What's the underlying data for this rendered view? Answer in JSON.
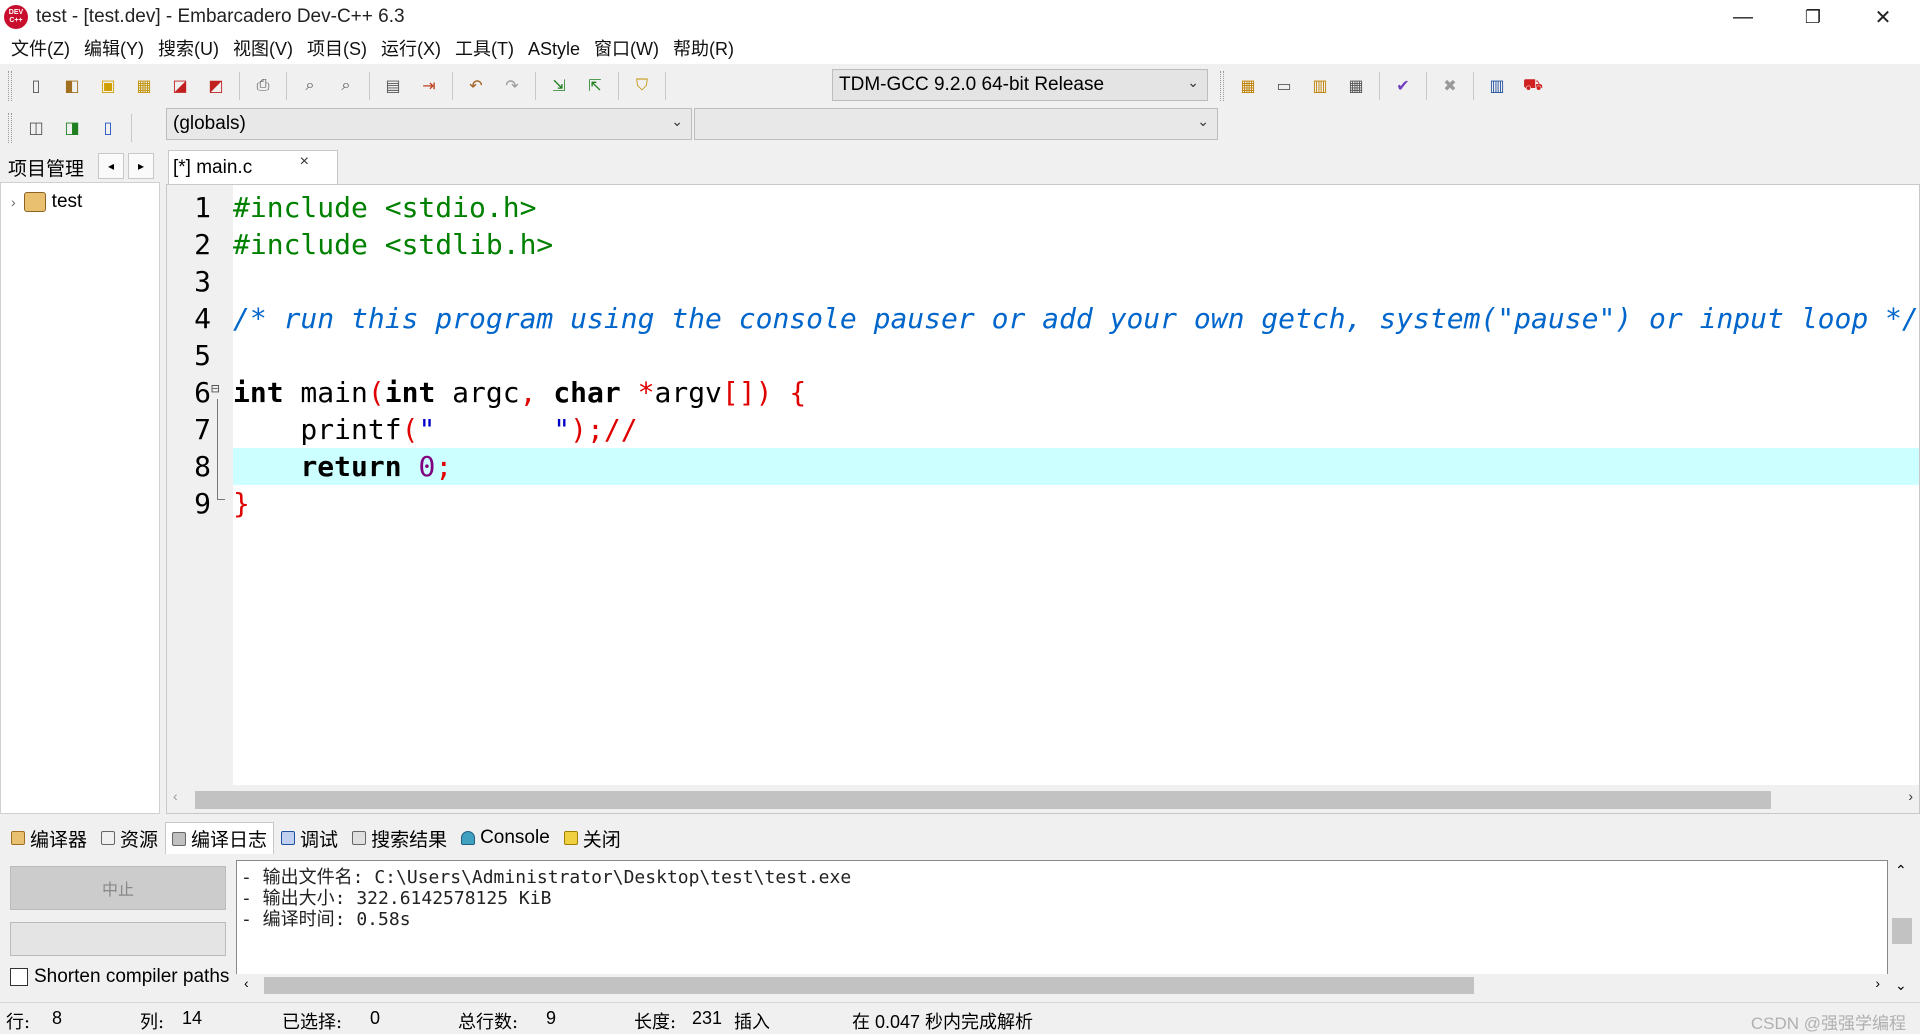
{
  "window": {
    "title": "test - [test.dev] - Embarcadero Dev-C++ 6.3",
    "app_icon_text": "DEV C++",
    "minimize": "—",
    "restore": "❐",
    "close": "✕"
  },
  "menu": [
    "文件(Z)",
    "编辑(Y)",
    "搜索(U)",
    "视图(V)",
    "项目(S)",
    "运行(X)",
    "工具(T)",
    "AStyle",
    "窗口(W)",
    "帮助(R)"
  ],
  "toolbar": {
    "compiler_select": "TDM-GCC 9.2.0 64-bit Release",
    "globals_select": "(globals)",
    "function_select": ""
  },
  "left_panel": {
    "tab_label": "项目管理",
    "prev": "◂",
    "next": "▸",
    "tree_root": "test",
    "expander": "›"
  },
  "editor": {
    "tab_label": "[*] main.c",
    "tab_close": "×",
    "line_numbers": [
      "1",
      "2",
      "3",
      "4",
      "5",
      "6",
      "7",
      "8",
      "9"
    ],
    "lines": {
      "l1": "#include <stdio.h>",
      "l2": "#include <stdlib.h>",
      "l4": "/* run this program using the console pauser or add your own getch, system(\"pause\") or input loop */",
      "l6_kw1": "int",
      "l6_main": " main",
      "l6_p1": "(",
      "l6_kw2": "int",
      "l6_argc": " argc",
      "l6_comma": ",",
      "l6_kw3": " char",
      "l6_star": " *",
      "l6_argv": "argv",
      "l6_br": "[])",
      "l6_brace": " {",
      "l7_indent": "    printf",
      "l7_p": "(",
      "l7_str": "\"       \"",
      "l7_end": ");//",
      "l8_indent": "    ",
      "l8_kw": "return",
      "l8_num": " 0",
      "l8_semi": ";",
      "l9": "}"
    },
    "current_line": 8
  },
  "bottom_tabs": [
    "编译器",
    "资源",
    "编译日志",
    "调试",
    "搜索结果",
    "Console",
    "关闭"
  ],
  "bottom_active_tab": "编译日志",
  "compile_panel": {
    "stop_label": "中止",
    "shorten_label": "Shorten compiler paths",
    "log_lines": [
      "- 输出文件名: C:\\Users\\Administrator\\Desktop\\test\\test.exe",
      "- 输出大小: 322.6142578125 KiB",
      "- 编译时间: 0.58s"
    ]
  },
  "statusbar": {
    "line_label": "行:",
    "line_value": "8",
    "col_label": "列:",
    "col_value": "14",
    "sel_label": "已选择:",
    "sel_value": "0",
    "total_label": "总行数:",
    "total_value": "9",
    "len_label": "长度:",
    "len_value": "231",
    "mode": "插入",
    "parse_msg": "在 0.047 秒内完成解析",
    "watermark": "CSDN @强强学编程"
  }
}
